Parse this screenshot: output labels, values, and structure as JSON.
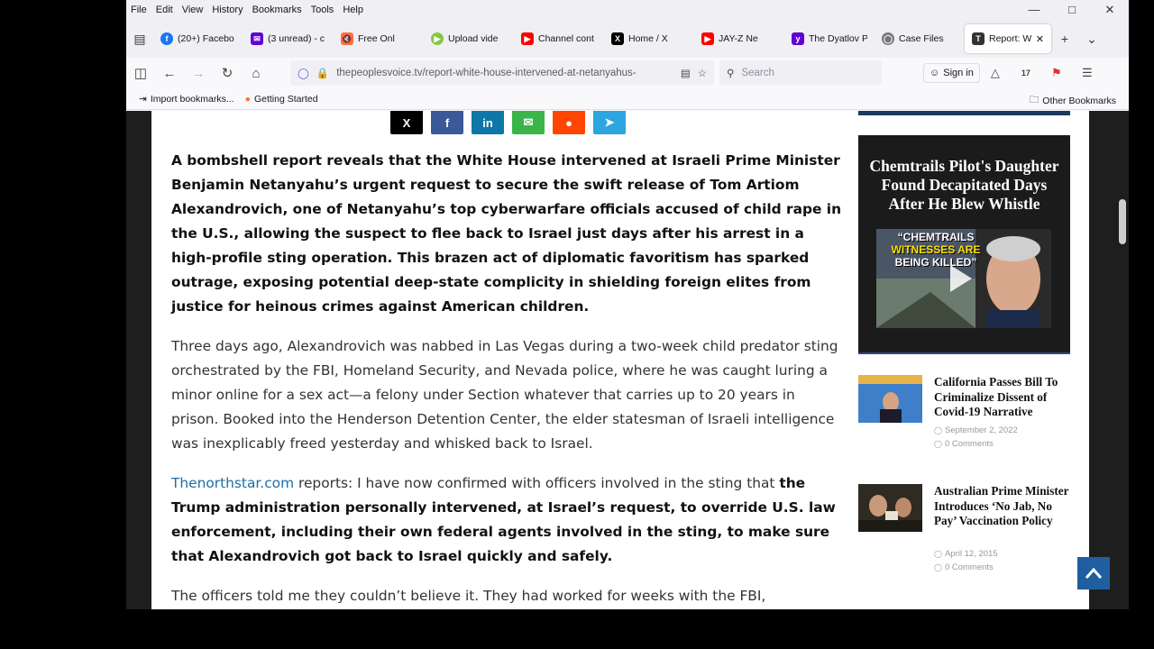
{
  "menubar": {
    "items": [
      "File",
      "Edit",
      "View",
      "History",
      "Bookmarks",
      "Tools",
      "Help"
    ]
  },
  "window_controls": {
    "minimize": "—",
    "maximize": "□",
    "close": "✕"
  },
  "tabs": [
    {
      "title": "(20+) Facebo",
      "icon": "facebook-icon",
      "color": "#1877f2"
    },
    {
      "title": "(3 unread) - c",
      "icon": "mail-icon",
      "color": "#6001d2"
    },
    {
      "title": "Free Onl",
      "icon": "audio-muted-icon",
      "color": "#ff7139"
    },
    {
      "title": "Upload vide",
      "icon": "rumble-icon",
      "color": "#85c742"
    },
    {
      "title": "Channel cont",
      "icon": "youtube-icon",
      "color": "#ff0000"
    },
    {
      "title": "Home / X",
      "icon": "x-icon",
      "color": "#000000"
    },
    {
      "title": "JAY-Z Ne",
      "icon": "youtube-icon",
      "color": "#ff0000"
    },
    {
      "title": "The Dyatlov P",
      "icon": "yahoo-icon",
      "color": "#5f01d1"
    },
    {
      "title": "Case Files",
      "icon": "globe-icon",
      "color": "#777777"
    },
    {
      "title": "Report: Wh",
      "icon": "site-icon",
      "color": "#333333",
      "active": true
    }
  ],
  "navbar": {
    "url": "thepeoplesvoice.tv/report-white-house-intervened-at-netanyahus-",
    "search_placeholder": "Search",
    "signin_label": "Sign in",
    "badge_count": "17"
  },
  "bookmarks": {
    "import_label": "Import bookmarks...",
    "getting_started_label": "Getting Started",
    "other_label": "Other Bookmarks"
  },
  "share_buttons": [
    {
      "name": "x",
      "glyph": "X",
      "color": "#000000"
    },
    {
      "name": "facebook",
      "glyph": "f",
      "color": "#3b5998"
    },
    {
      "name": "linkedin",
      "glyph": "in",
      "color": "#0e76a8"
    },
    {
      "name": "email",
      "glyph": "✉",
      "color": "#3bb54a"
    },
    {
      "name": "reddit",
      "glyph": "●",
      "color": "#ff4500"
    },
    {
      "name": "telegram",
      "glyph": "➤",
      "color": "#2ca5e0"
    }
  ],
  "article": {
    "lead": "A bombshell report reveals that the White House intervened at Israeli Prime Minister Benjamin Netanyahu’s urgent request to secure the swift release of Tom Artiom Alexandrovich, one of Netanyahu’s top cyberwarfare officials accused of child rape in the U.S., allowing the suspect to flee back to Israel just days after his arrest in a high-profile sting operation. This brazen act of diplomatic favoritism has sparked outrage, exposing potential deep-state complicity in shielding foreign elites from justice for heinous crimes against American children.",
    "para2": "Three days ago, Alexandrovich was nabbed in Las Vegas during a two-week child predator sting orchestrated by the FBI, Homeland Security, and Nevada police, where he was caught luring a minor online for a sex act—a felony under Section whatever that carries up to 20 years in prison. Booked into the Henderson Detention Center, the elder statesman of Israeli intelligence was inexplicably freed yesterday and whisked back to Israel.",
    "para3_link": "Thenorthstar.com",
    "para3_text": " reports: I have now confirmed with officers involved in the sting that ",
    "para3_bold": "the Trump administration personally intervened, at Israel’s request, to override U.S. law enforcement, including their own federal agents involved in the sting, to make sure that Alexandrovich got back to Israel quickly and safely.",
    "para4": "The officers told me they couldn’t believe it. They had worked for weeks with the FBI,"
  },
  "sidebar": {
    "video": {
      "title": "Chemtrails Pilot's Daughter Found Decapitated Days After He Blew Whistle",
      "caption_white1": "“CHEMTRAILS",
      "caption_yellow": "WITNESSES ARE",
      "caption_white2": "BEING KILLED”"
    },
    "posts": [
      {
        "title": "California Passes Bill To Criminalize Dissent of Covid-19 Narrative",
        "date": "September 2, 2022",
        "comments": "0 Comments"
      },
      {
        "title": "Australian Prime Minister Introduces ‘No Jab, No Pay’ Vaccination Policy",
        "date": "April 12, 2015",
        "comments": "0 Comments"
      }
    ]
  }
}
